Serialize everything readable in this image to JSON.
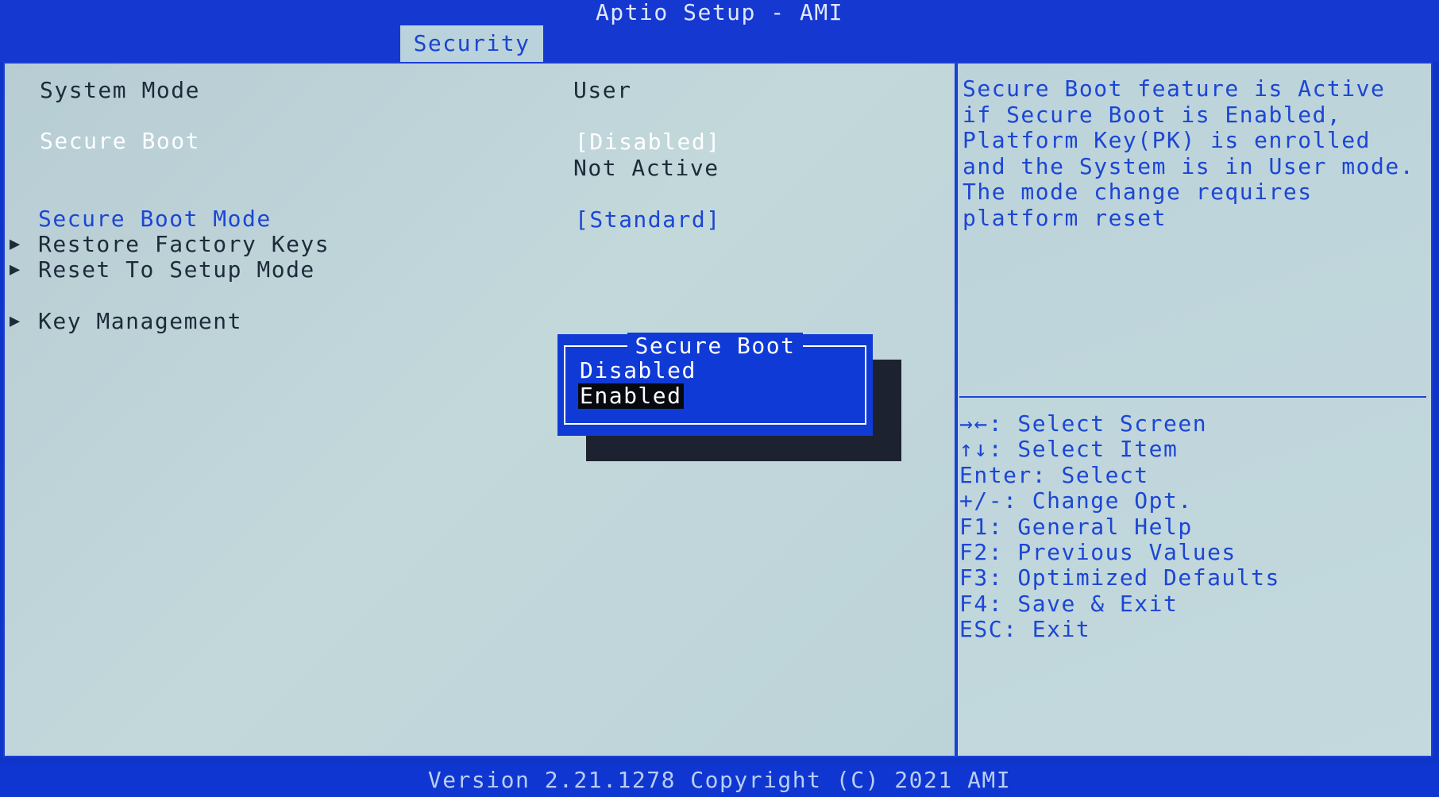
{
  "app_title": "Aptio Setup - AMI",
  "active_tab": "Security",
  "settings": {
    "system_mode_label": "System Mode",
    "system_mode_value": "User",
    "secure_boot_label": "Secure Boot",
    "secure_boot_value": "[Disabled]",
    "secure_boot_status": "Not Active",
    "secure_boot_mode_label": "Secure Boot Mode",
    "secure_boot_mode_value": "[Standard]",
    "restore_factory_keys": "Restore Factory Keys",
    "reset_to_setup_mode": "Reset To Setup Mode",
    "key_management": "Key Management"
  },
  "help_text": "Secure Boot feature is Active\nif Secure Boot is Enabled,\nPlatform Key(PK) is enrolled\nand the System is in User mode.\nThe mode change requires\nplatform reset",
  "key_hints": [
    "→←: Select Screen",
    "↑↓: Select Item",
    "Enter: Select",
    "+/-: Change Opt.",
    "F1: General Help",
    "F2: Previous Values",
    "F3: Optimized Defaults",
    "F4: Save & Exit",
    "ESC: Exit"
  ],
  "popup": {
    "title": "Secure Boot",
    "options": [
      "Disabled",
      "Enabled"
    ],
    "selected": "Enabled"
  },
  "footer": "Version 2.21.1278 Copyright (C) 2021 AMI",
  "icons": {
    "submenu_arrow": "triangle-right-icon"
  },
  "colors": {
    "header_blue": "#1438d0",
    "panel_bg": "#bcd3d8",
    "text_blue": "#1b46d4",
    "text_dark": "#1e2b3a",
    "popup_blue": "#0f3ad6",
    "highlight": "#06090f"
  }
}
